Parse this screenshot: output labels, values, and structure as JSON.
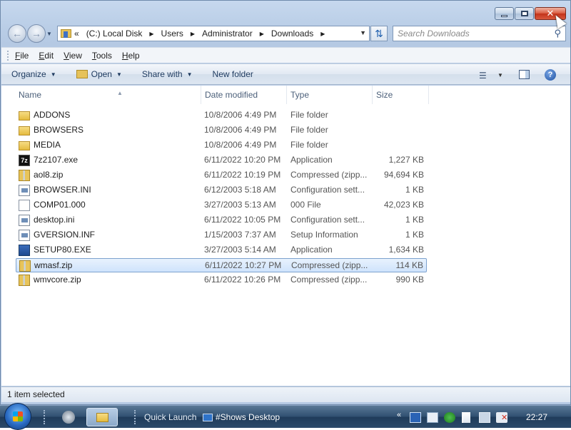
{
  "window": {
    "minimize_icon": "minimize-icon",
    "maximize_icon": "maximize-icon",
    "close_glyph": "✕"
  },
  "address_bar": {
    "overflow_glyph": "«",
    "crumbs": [
      "(C:) Local Disk",
      "Users",
      "Administrator",
      "Downloads"
    ],
    "refresh_icon": "refresh-icon"
  },
  "search": {
    "placeholder": "Search Downloads"
  },
  "menu": {
    "file": "File",
    "edit": "Edit",
    "view": "View",
    "tools": "Tools",
    "help": "Help"
  },
  "commands": {
    "organize": "Organize",
    "open": "Open",
    "share_with": "Share with",
    "new_folder": "New folder"
  },
  "columns": {
    "name": "Name",
    "date_modified": "Date modified",
    "type": "Type",
    "size": "Size"
  },
  "files": [
    {
      "name": "ADDONS",
      "date": "10/8/2006 4:49 PM",
      "type": "File folder",
      "size": "",
      "icon": "folder"
    },
    {
      "name": "BROWSERS",
      "date": "10/8/2006 4:49 PM",
      "type": "File folder",
      "size": "",
      "icon": "folder"
    },
    {
      "name": "MEDIA",
      "date": "10/8/2006 4:49 PM",
      "type": "File folder",
      "size": "",
      "icon": "folder"
    },
    {
      "name": "7z2107.exe",
      "date": "6/11/2022 10:20 PM",
      "type": "Application",
      "size": "1,227 KB",
      "icon": "7z"
    },
    {
      "name": "aol8.zip",
      "date": "6/11/2022 10:19 PM",
      "type": "Compressed (zipp...",
      "size": "94,694 KB",
      "icon": "zip"
    },
    {
      "name": "BROWSER.INI",
      "date": "6/12/2003 5:18 AM",
      "type": "Configuration sett...",
      "size": "1 KB",
      "icon": "ini"
    },
    {
      "name": "COMP01.000",
      "date": "3/27/2003 5:13 AM",
      "type": "000 File",
      "size": "42,023 KB",
      "icon": "file"
    },
    {
      "name": "desktop.ini",
      "date": "6/11/2022 10:05 PM",
      "type": "Configuration sett...",
      "size": "1 KB",
      "icon": "ini"
    },
    {
      "name": "GVERSION.INF",
      "date": "1/15/2003 7:37 AM",
      "type": "Setup Information",
      "size": "1 KB",
      "icon": "ini"
    },
    {
      "name": "SETUP80.EXE",
      "date": "3/27/2003 5:14 AM",
      "type": "Application",
      "size": "1,634 KB",
      "icon": "exe"
    },
    {
      "name": "wmasf.zip",
      "date": "6/11/2022 10:27 PM",
      "type": "Compressed (zipp...",
      "size": "114 KB",
      "icon": "zip",
      "selected": true
    },
    {
      "name": "wmvcore.zip",
      "date": "6/11/2022 10:26 PM",
      "type": "Compressed (zipp...",
      "size": "990 KB",
      "icon": "zip"
    }
  ],
  "status": {
    "text": "1 item selected"
  },
  "taskbar": {
    "quick_launch": "Quick Launch",
    "shows_desktop": "#Shows Desktop",
    "tray_expand": "«",
    "clock": "22:27"
  },
  "colors": {
    "selection_border": "#7da2ce",
    "close_button": "#c2331a",
    "taskbar": "#2f4f70"
  }
}
